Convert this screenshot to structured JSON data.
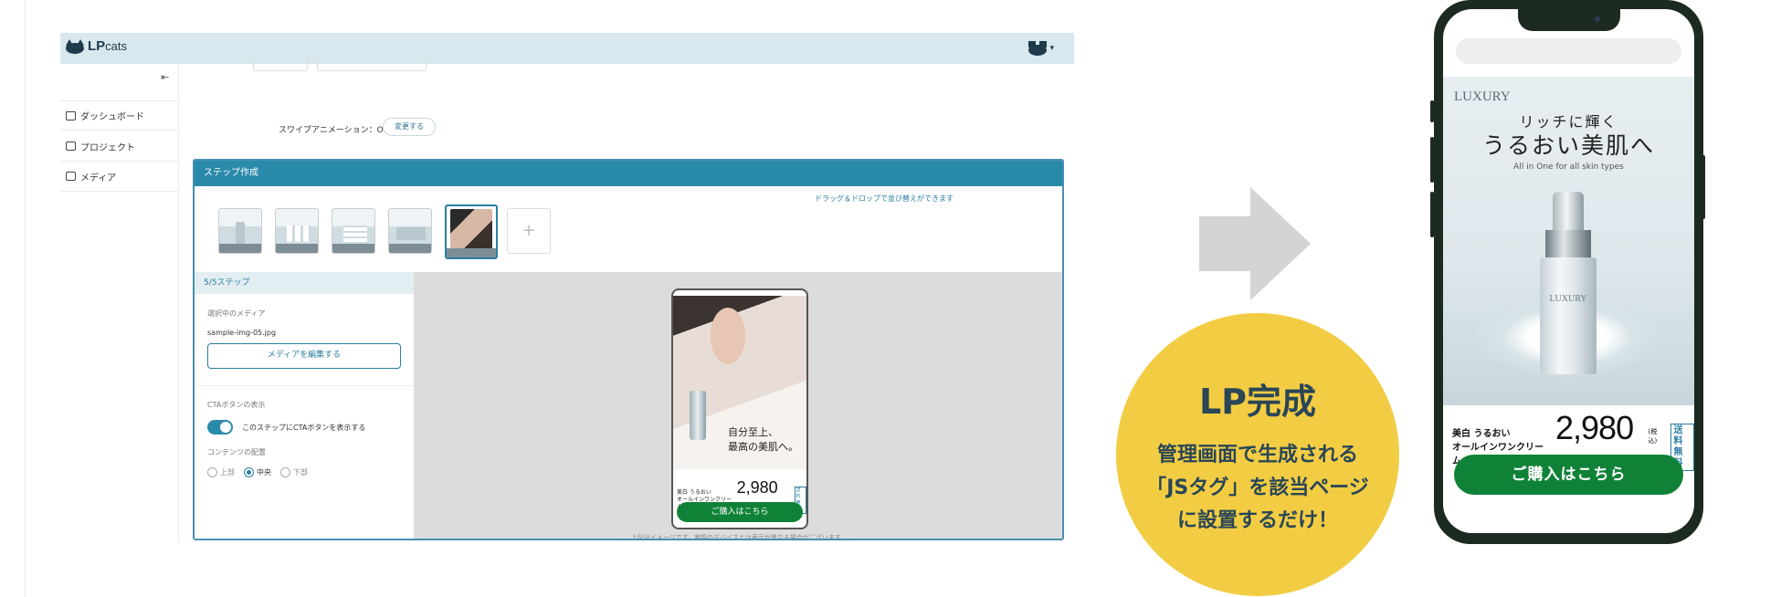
{
  "admin": {
    "logo": {
      "main": "LP",
      "sub": "cats"
    },
    "sidebar": {
      "items": [
        {
          "icon": "home-icon",
          "label": "ダッシュボード"
        },
        {
          "icon": "folder-icon",
          "label": "プロジェクト"
        },
        {
          "icon": "image-icon",
          "label": "メディア"
        }
      ]
    },
    "settings": {
      "swipe_animation": "スワイプアニメーション：OFF",
      "change_button": "変更する"
    },
    "step_editor": {
      "header": "ステップ作成",
      "drag_hint": "ドラッグ＆ドロップで並び替えができます",
      "step_count": "5/5ステップ",
      "selected_media_label": "選択中のメディア",
      "file_name": "sample-img-05.jpg",
      "edit_media_button": "メディアを編集する",
      "cta_label": "CTAボタンの表示",
      "cta_toggle_label": "このステップにCTAボタンを表示する",
      "cta_enabled": true,
      "placement_label": "コンテンツの配置",
      "placement_options": [
        "上部",
        "中央",
        "下部"
      ],
      "placement_selected": "中央",
      "preview_note": "上記はイメージです。実際のデバイスとは表示が異なる場合がございます。"
    },
    "preview": {
      "tagline": [
        "自分至上、",
        "最高の美肌へ。"
      ],
      "product": [
        "美白 うるおい",
        "オールインワンクリーム"
      ],
      "price": "2,980円",
      "badge": [
        "送料",
        "無料"
      ],
      "buy_button": "ご購入はこちら"
    }
  },
  "result": {
    "title": "LP完成",
    "description": [
      "管理画面で生成される",
      "「JSタグ」を該当ページ",
      "に設置するだけ！"
    ],
    "circle_color": "#f2cd44"
  },
  "phone": {
    "brand": "LUXURY",
    "tagline_small": "リッチに輝く",
    "tagline_large": "うるおい美肌へ",
    "tagline_en": "All in One for all skin types",
    "bottle_label": "LUXURY",
    "product": [
      "美白 うるおい",
      "オールインワンクリーム"
    ],
    "price": "2,980",
    "currency": "円",
    "tax": "(税込)",
    "badge": [
      "送料",
      "無料"
    ],
    "buy_button": "ご購入はこちら",
    "button_color": "#108238"
  }
}
